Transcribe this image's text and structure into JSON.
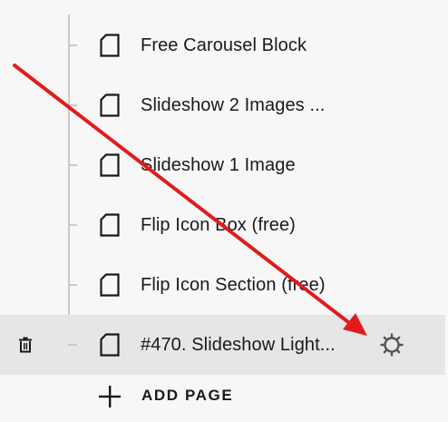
{
  "pages": [
    {
      "label": "Free Carousel Block",
      "icon": "page-icon",
      "selected": false
    },
    {
      "label": "Slideshow 2 Images ...",
      "icon": "page-icon",
      "selected": false
    },
    {
      "label": "Slideshow 1 Image",
      "icon": "page-icon",
      "selected": false
    },
    {
      "label": "Flip Icon Box (free)",
      "icon": "page-icon",
      "selected": false
    },
    {
      "label": "Flip Icon Section (free)",
      "icon": "page-icon",
      "selected": false
    },
    {
      "label": "#470. Slideshow Light...",
      "icon": "page-icon",
      "selected": true
    }
  ],
  "selected_row_actions": {
    "delete_icon": "trash-icon",
    "settings_icon": "gear-icon"
  },
  "add_page": {
    "label": "ADD PAGE",
    "icon": "plus-icon"
  },
  "annotation": {
    "type": "arrow",
    "color": "#e01b1b"
  },
  "colors": {
    "background": "#f7f7f7",
    "selected_row": "#e6e6e6",
    "tree_line": "#c9c9c9",
    "text": "#1a1a1a",
    "arrow": "#e01b1b"
  }
}
